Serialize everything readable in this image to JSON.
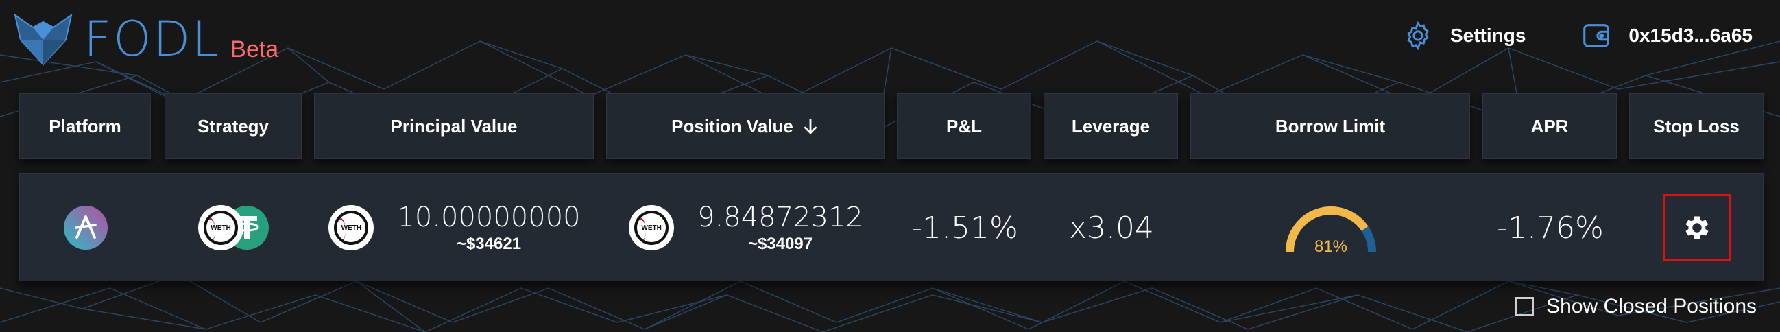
{
  "brand": {
    "name": "FODL",
    "badge": "Beta"
  },
  "top_nav": {
    "settings_label": "Settings",
    "wallet_address": "0x15d3...6a65"
  },
  "table": {
    "columns": [
      "Platform",
      "Strategy",
      "Principal Value",
      "Position Value",
      "P&L",
      "Leverage",
      "Borrow Limit",
      "APR",
      "Stop Loss"
    ],
    "sorted_column": "Position Value",
    "sort_direction": "descending",
    "rows": [
      {
        "platform_icon": "aave-icon",
        "strategy_tokens": [
          "WETH",
          "tether-icon"
        ],
        "principal_token": "WETH",
        "principal_value": "10.00000000",
        "principal_usd": "~$34621",
        "position_token": "WETH",
        "position_value": "9.84872312",
        "position_usd": "~$34097",
        "pnl": "-1.51%",
        "leverage": "x3.04",
        "borrow_limit": "81%",
        "borrow_limit_fraction": 0.81,
        "apr": "-1.76%",
        "stop_loss_icon": "gear-icon"
      }
    ]
  },
  "footer": {
    "show_closed_label": "Show Closed Positions",
    "show_closed_checked": false
  },
  "colors": {
    "accent": "#4a90d9",
    "beta": "#ff6b6b",
    "gauge_fill": "#f2b94a",
    "gauge_track": "#1f5f96",
    "highlight": "#e01010"
  }
}
